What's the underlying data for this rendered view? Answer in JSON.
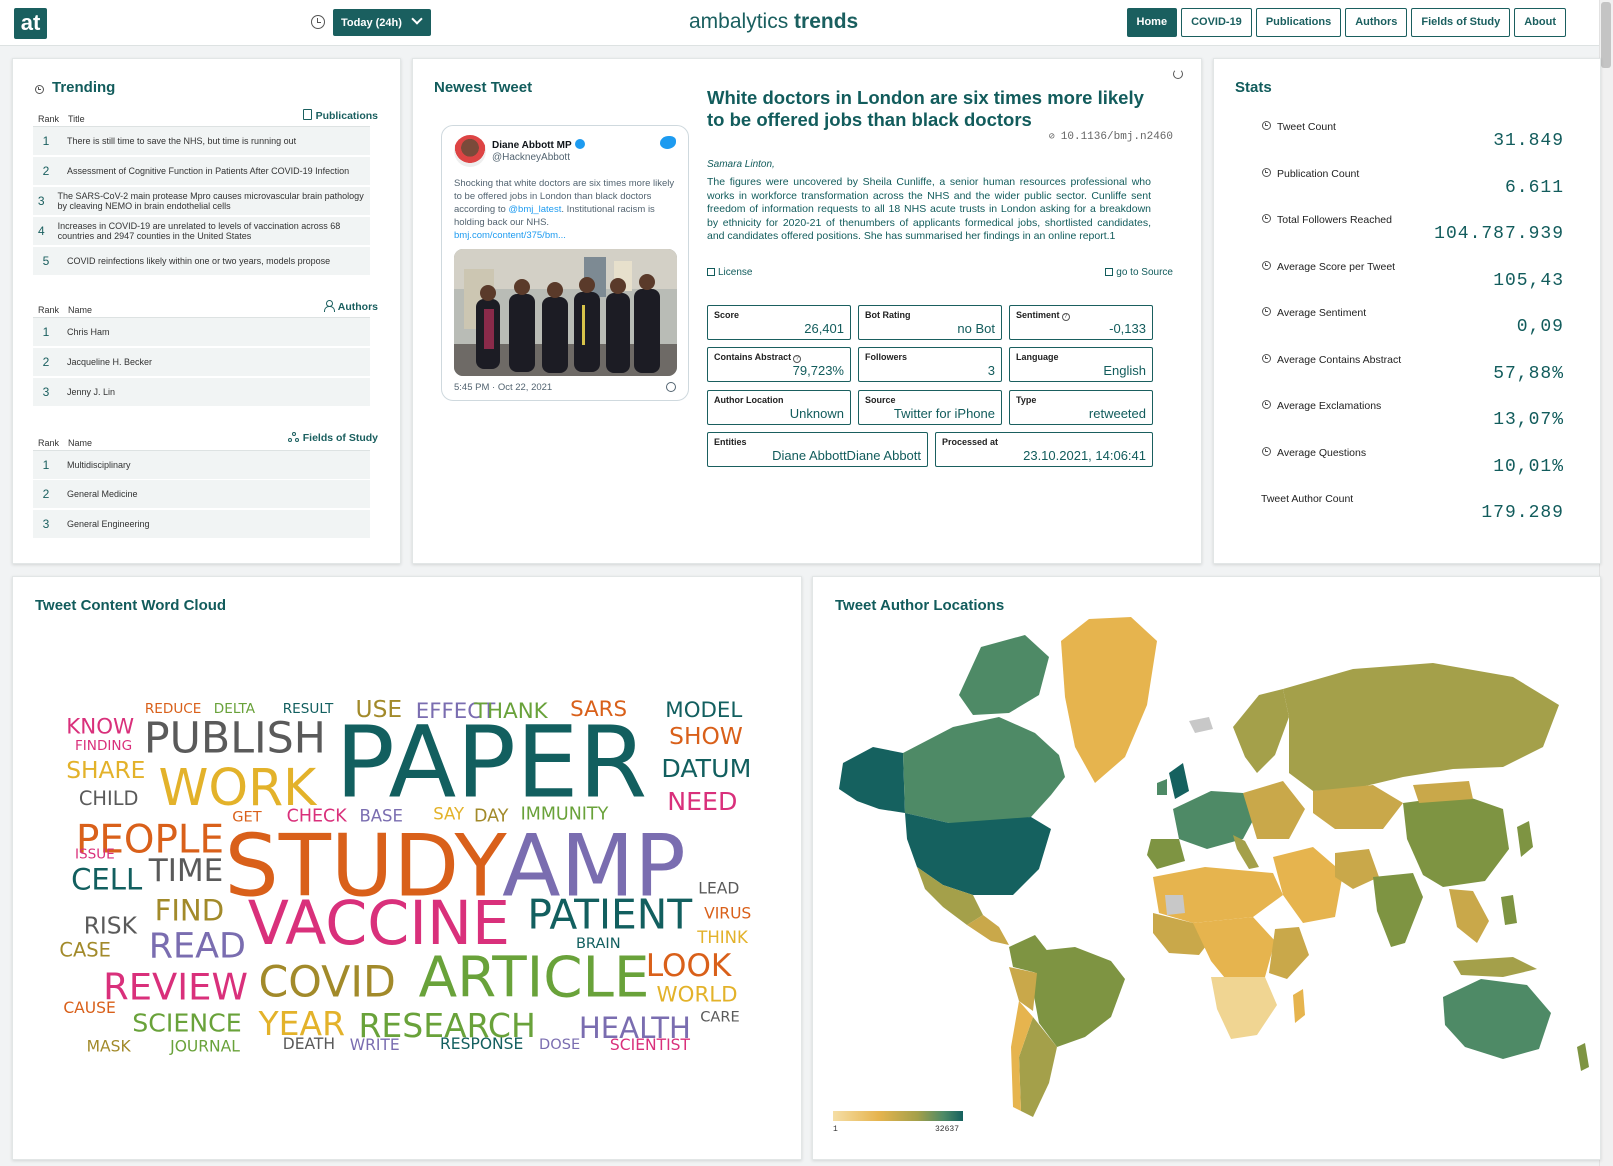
{
  "header": {
    "logo_text": "at",
    "range_label": "Today (24h)",
    "brand_light": "ambalytics",
    "brand_bold": "trends",
    "nav": [
      "Home",
      "COVID-19",
      "Publications",
      "Authors",
      "Fields of Study",
      "About"
    ],
    "active_nav": "Home"
  },
  "trending": {
    "title": "Trending",
    "publications": {
      "col_rank": "Rank",
      "col_title": "Title",
      "link": "Publications",
      "rows": [
        {
          "rank": "1",
          "text": "There is still time to save the NHS, but time is running out"
        },
        {
          "rank": "2",
          "text": "Assessment of Cognitive Function in Patients After COVID-19 Infection"
        },
        {
          "rank": "3",
          "text": "The SARS-CoV-2 main protease Mpro causes microvascular brain pathology by cleaving NEMO in brain endothelial cells"
        },
        {
          "rank": "4",
          "text": "Increases in COVID-19 are unrelated to levels of vaccination across 68 countries and 2947 counties in the United States"
        },
        {
          "rank": "5",
          "text": "COVID reinfections likely within one or two years, models propose"
        }
      ]
    },
    "authors": {
      "col_rank": "Rank",
      "col_name": "Name",
      "link": "Authors",
      "rows": [
        {
          "rank": "1",
          "text": "Chris Ham"
        },
        {
          "rank": "2",
          "text": "Jacqueline H. Becker"
        },
        {
          "rank": "3",
          "text": "Jenny J. Lin"
        }
      ]
    },
    "fields": {
      "col_rank": "Rank",
      "col_name": "Name",
      "link": "Fields of Study",
      "rows": [
        {
          "rank": "1",
          "text": "Multidisciplinary"
        },
        {
          "rank": "2",
          "text": "General Medicine"
        },
        {
          "rank": "3",
          "text": "General Engineering"
        }
      ]
    }
  },
  "newest": {
    "title": "Newest Tweet",
    "tweet": {
      "name": "Diane Abbott MP",
      "handle": "@HackneyAbbott",
      "text_before": "Shocking that white doctors are six times more likely to be offered jobs in London than black doctors according to ",
      "mention": "@bmj_latest",
      "text_after": ". Institutional racism is holding back our NHS.",
      "link": "bmj.com/content/375/bm...",
      "time": "5:45 PM · Oct 22, 2021"
    },
    "headline": "White doctors in London are six times more likely to be offered jobs than black doctors",
    "doi": "10.1136/bmj.n2460",
    "author": "Samara Linton,",
    "abstract": "The figures were uncovered by Sheila Cunliffe, a senior human resources professional who works in workforce transformation across the NHS and the wider public sector. Cunliffe sent freedom of information requests to all 18 NHS acute trusts in London asking for a breakdown by ethnicity for 2020-21 of thenumbers of applicants formedical jobs, shortlisted candidates, and candidates offered positions. She has summarised her findings in an online report.1",
    "license_label": "License",
    "source_label": "go to Source",
    "metrics": {
      "score": {
        "label": "Score",
        "value": "26,401"
      },
      "bot": {
        "label": "Bot Rating",
        "value": "no Bot"
      },
      "sentiment": {
        "label": "Sentiment",
        "value": "-0,133"
      },
      "abstract": {
        "label": "Contains Abstract",
        "value": "79,723%"
      },
      "followers": {
        "label": "Followers",
        "value": "3"
      },
      "language": {
        "label": "Language",
        "value": "English"
      },
      "location": {
        "label": "Author Location",
        "value": "Unknown"
      },
      "source": {
        "label": "Source",
        "value": "Twitter for iPhone"
      },
      "type": {
        "label": "Type",
        "value": "retweeted"
      },
      "entities": {
        "label": "Entities",
        "value": "Diane AbbottDiane Abbott"
      },
      "processed": {
        "label": "Processed at",
        "value": "23.10.2021, 14:06:41"
      }
    }
  },
  "stats": {
    "title": "Stats",
    "items": [
      {
        "label": "Tweet Count",
        "value": "31.849"
      },
      {
        "label": "Publication Count",
        "value": "6.611"
      },
      {
        "label": "Total Followers Reached",
        "value": "104.787.939"
      },
      {
        "label": "Average Score per Tweet",
        "value": "105,43"
      },
      {
        "label": "Average Sentiment",
        "value": "0,09"
      },
      {
        "label": "Average Contains Abstract",
        "value": "57,88%"
      },
      {
        "label": "Average Exclamations",
        "value": "13,07%"
      },
      {
        "label": "Average Questions",
        "value": "10,01%"
      },
      {
        "label": "Tweet Author Count",
        "value": "179.289"
      }
    ]
  },
  "wordcloud": {
    "title": "Tweet Content Word Cloud",
    "words": [
      {
        "text": "PAPER",
        "color": "#125f5f"
      },
      {
        "text": "STUDY",
        "color": "#d9601a"
      },
      {
        "text": "AMP",
        "color": "#7a6db0"
      },
      {
        "text": "VACCINE",
        "color": "#d9307b"
      },
      {
        "text": "ARTICLE",
        "color": "#69a23a"
      },
      {
        "text": "PATIENT",
        "color": "#125f5f"
      },
      {
        "text": "WORK",
        "color": "#e3b22a"
      },
      {
        "text": "PUBLISH",
        "color": "#5a5a5a"
      },
      {
        "text": "PEOPLE",
        "color": "#d9601a"
      },
      {
        "text": "COVID",
        "color": "#a28a2a"
      },
      {
        "text": "REVIEW",
        "color": "#d9307b"
      },
      {
        "text": "RESEARCH",
        "color": "#69a23a"
      },
      {
        "text": "YEAR",
        "color": "#e3b22a"
      },
      {
        "text": "HEALTH",
        "color": "#7a6db0"
      },
      {
        "text": "READ",
        "color": "#7a6db0"
      },
      {
        "text": "TIME",
        "color": "#5a5a5a"
      },
      {
        "text": "CELL",
        "color": "#125f5f"
      },
      {
        "text": "FIND",
        "color": "#a28a2a"
      },
      {
        "text": "LOOK",
        "color": "#d9601a"
      },
      {
        "text": "SCIENCE",
        "color": "#69a23a"
      },
      {
        "text": "DATUM",
        "color": "#125f5f"
      },
      {
        "text": "NEED",
        "color": "#d9307b"
      },
      {
        "text": "SHOW",
        "color": "#d9601a"
      },
      {
        "text": "MODEL",
        "color": "#125f5f"
      },
      {
        "text": "USE",
        "color": "#a28a2a"
      },
      {
        "text": "EFFECT",
        "color": "#7a6db0"
      },
      {
        "text": "THANK",
        "color": "#69a23a"
      },
      {
        "text": "SARS",
        "color": "#d9601a"
      },
      {
        "text": "KNOW",
        "color": "#d9307b"
      },
      {
        "text": "SHARE",
        "color": "#e3b22a"
      },
      {
        "text": "CHILD",
        "color": "#5a5a5a"
      },
      {
        "text": "RISK",
        "color": "#5a5a5a"
      },
      {
        "text": "CASE",
        "color": "#a28a2a"
      },
      {
        "text": "WORLD",
        "color": "#e3b22a"
      },
      {
        "text": "IMMUNITY",
        "color": "#69a23a"
      },
      {
        "text": "CHECK",
        "color": "#d9307b"
      },
      {
        "text": "BASE",
        "color": "#7a6db0"
      },
      {
        "text": "SAY",
        "color": "#e3b22a"
      },
      {
        "text": "DAY",
        "color": "#a28a2a"
      },
      {
        "text": "GET",
        "color": "#d9601a"
      },
      {
        "text": "REDUCE",
        "color": "#d9601a"
      },
      {
        "text": "DELTA",
        "color": "#69a23a"
      },
      {
        "text": "RESULT",
        "color": "#125f5f"
      },
      {
        "text": "FINDING",
        "color": "#d9307b"
      },
      {
        "text": "ISSUE",
        "color": "#d9307b"
      },
      {
        "text": "LEAD",
        "color": "#5a5a5a"
      },
      {
        "text": "VIRUS",
        "color": "#d9601a"
      },
      {
        "text": "THINK",
        "color": "#e3b22a"
      },
      {
        "text": "BRAIN",
        "color": "#125f5f"
      },
      {
        "text": "CAUSE",
        "color": "#d9601a"
      },
      {
        "text": "CARE",
        "color": "#5a5a5a"
      },
      {
        "text": "MASK",
        "color": "#a28a2a"
      },
      {
        "text": "JOURNAL",
        "color": "#69a23a"
      },
      {
        "text": "DEATH",
        "color": "#5a5a5a"
      },
      {
        "text": "WRITE",
        "color": "#7a6db0"
      },
      {
        "text": "RESPONSE",
        "color": "#125f5f"
      },
      {
        "text": "DOSE",
        "color": "#7a6db0"
      },
      {
        "text": "SCIENTIST",
        "color": "#d9307b"
      }
    ]
  },
  "map": {
    "title": "Tweet Author Locations",
    "legend_min": "1",
    "legend_max": "32637",
    "colors": {
      "low": "#f5dea6",
      "mid": "#e6b44e",
      "high": "#15615f",
      "none": "#c8c8c8"
    }
  }
}
